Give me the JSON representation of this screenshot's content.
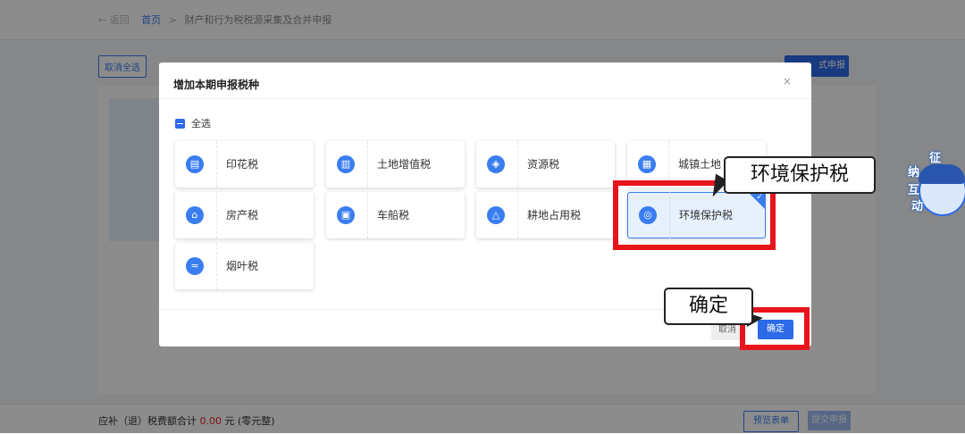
{
  "breadcrumb": {
    "back_label": "← 返回",
    "home": "首页",
    "separator": ">",
    "current": "财产和行为税税源采集及合并申报"
  },
  "toolbar": {
    "cancel_all": "取消全选",
    "formal_submit": "式申报"
  },
  "footer": {
    "total_label": "应补（退）税费额合计",
    "total_amount": "0.00",
    "total_unit": "元",
    "total_words": "(零元整)",
    "preview": "预览表单",
    "submit": "提交申报"
  },
  "modal": {
    "title": "增加本期申报税种",
    "close": "×",
    "select_all": "全选",
    "cancel": "取消",
    "ok": "确定",
    "items": [
      {
        "label": "印花税",
        "icon": "stamp-icon",
        "selected": false
      },
      {
        "label": "土地增值税",
        "icon": "land-icon",
        "selected": false
      },
      {
        "label": "资源税",
        "icon": "resource-icon",
        "selected": false
      },
      {
        "label": "城镇土地",
        "icon": "building-icon",
        "selected": false
      },
      {
        "label": "房产税",
        "icon": "house-icon",
        "selected": false
      },
      {
        "label": "车船税",
        "icon": "vehicle-icon",
        "selected": false
      },
      {
        "label": "耕地占用税",
        "icon": "farmland-icon",
        "selected": false
      },
      {
        "label": "环境保护税",
        "icon": "environment-icon",
        "selected": true
      },
      {
        "label": "烟叶税",
        "icon": "leaf-icon",
        "selected": false
      }
    ]
  },
  "annotations": {
    "callout_item": "环境保护税",
    "callout_ok": "确定"
  },
  "mascot": {
    "chars": [
      "纳",
      "征",
      "互",
      "动"
    ]
  },
  "colors": {
    "accent": "#2d6ae8",
    "highlight": "#e8141c",
    "amount": "#e02020"
  }
}
